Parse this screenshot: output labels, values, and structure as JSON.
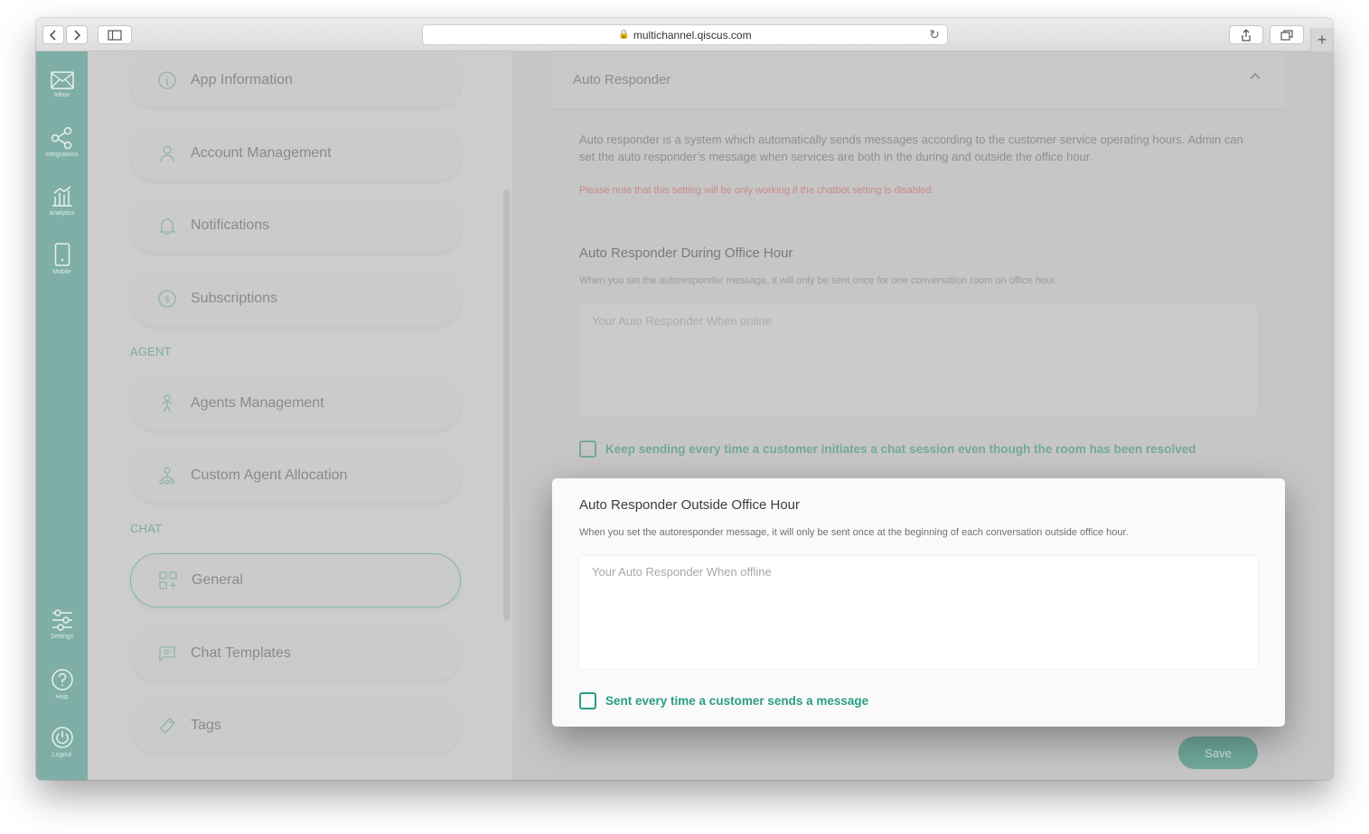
{
  "browser": {
    "url": "multichannel.qiscus.com"
  },
  "rail": {
    "items": [
      {
        "label": "Inbox",
        "icon": "inbox-icon"
      },
      {
        "label": "Integrations",
        "icon": "integrations-icon"
      },
      {
        "label": "Analytics",
        "icon": "analytics-icon"
      },
      {
        "label": "Mobile",
        "icon": "mobile-icon"
      },
      {
        "label": "Settings",
        "icon": "settings-icon"
      },
      {
        "label": "Help",
        "icon": "help-icon"
      },
      {
        "label": "Logout",
        "icon": "logout-icon"
      }
    ]
  },
  "menu": {
    "app_information": "App Information",
    "account_management": "Account Management",
    "notifications": "Notifications",
    "subscriptions": "Subscriptions",
    "section_agent": "AGENT",
    "agents_management": "Agents Management",
    "custom_agent_allocation": "Custom Agent Allocation",
    "section_chat": "CHAT",
    "general": "General",
    "chat_templates": "Chat Templates",
    "tags": "Tags"
  },
  "panel": {
    "title": "Auto Responder",
    "description": "Auto responder is a system which automatically sends messages according to the customer service operating hours. Admin can set the auto responder’s message when services are both in the during and outside the office hour.",
    "note": "Please note that this setting will be only working if the chatbot setting is disabled.",
    "during": {
      "title": "Auto Responder During Office Hour",
      "hint": "When you set the autoresponder message, it will only be sent once for one conversation room on office hour.",
      "placeholder": "Your Auto Responder When online",
      "checkbox_label": "Keep sending every time a customer initiates a chat session even though the room has been resolved"
    },
    "outside": {
      "title": "Auto Responder Outside Office Hour",
      "hint": "When you set the autoresponder message, it will only be sent once at the beginning of each conversation outside office hour.",
      "placeholder": "Your Auto Responder When offline",
      "checkbox_label": "Sent every time a customer sends a message"
    },
    "save_label": "Save"
  },
  "colors": {
    "accent": "#2a9d86",
    "rail": "#7faea7",
    "note": "#c98a8a"
  }
}
